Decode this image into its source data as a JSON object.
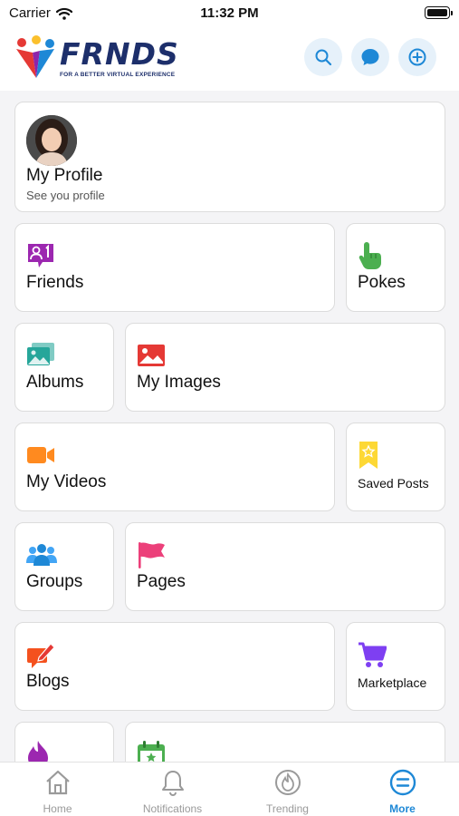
{
  "status": {
    "carrier": "Carrier",
    "time": "11:32 PM"
  },
  "header": {
    "brand": "FRNDS",
    "tagline": "FOR A BETTER VIRTUAL EXPERIENCE",
    "accent": "#1e88d6"
  },
  "profile": {
    "name": "My Profile",
    "subtitle": "See you profile"
  },
  "menu": {
    "friends": "Friends",
    "pokes": "Pokes",
    "albums": "Albums",
    "my_images": "My Images",
    "my_videos": "My Videos",
    "saved_posts": "Saved Posts",
    "groups": "Groups",
    "pages": "Pages",
    "blogs": "Blogs",
    "marketplace": "Marketplace"
  },
  "tabs": [
    {
      "label": "Home",
      "icon": "home-icon"
    },
    {
      "label": "Notifications",
      "icon": "bell-icon"
    },
    {
      "label": "Trending",
      "icon": "flame-icon"
    },
    {
      "label": "More",
      "icon": "menu-icon",
      "active": true
    }
  ]
}
